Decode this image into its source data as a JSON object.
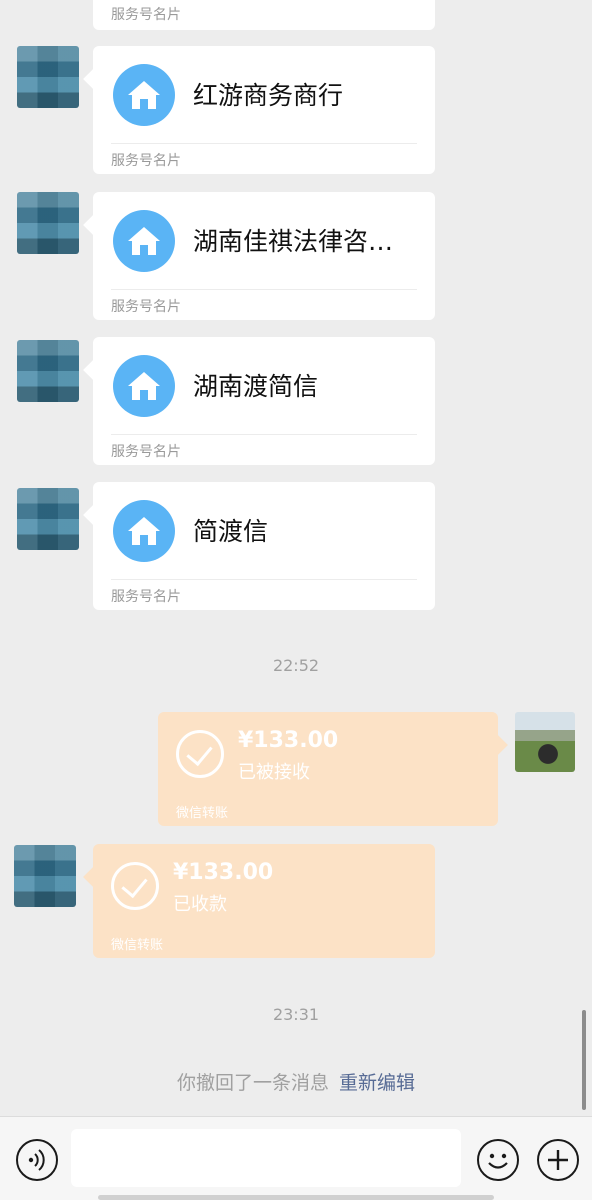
{
  "cards": [
    {
      "title": "红游商务商行",
      "footer": "服务号名片"
    },
    {
      "title": "湖南佳祺法律咨…",
      "footer": "服务号名片"
    },
    {
      "title": "湖南渡简信",
      "footer": "服务号名片"
    },
    {
      "title": "简渡信",
      "footer": "服务号名片"
    }
  ],
  "partial_card_footer": "服务号名片",
  "timestamps": [
    "22:52",
    "23:31"
  ],
  "transfer_sent": {
    "amount": "¥133.00",
    "status": "已被接收",
    "label": "微信转账"
  },
  "transfer_received": {
    "amount": "¥133.00",
    "status": "已收款",
    "label": "微信转账"
  },
  "recall": {
    "text": "你撤回了一条消息",
    "action": "重新编辑"
  },
  "input": {
    "value": "",
    "placeholder": ""
  },
  "icons": {
    "card_icon": "home-icon",
    "voice": "voice-icon",
    "emoji": "emoji-icon",
    "plus": "plus-icon"
  },
  "colors": {
    "background": "#ededed",
    "card_icon": "#5ab4f5",
    "transfer_bubble": "#fce2c6",
    "link": "#576b95"
  }
}
